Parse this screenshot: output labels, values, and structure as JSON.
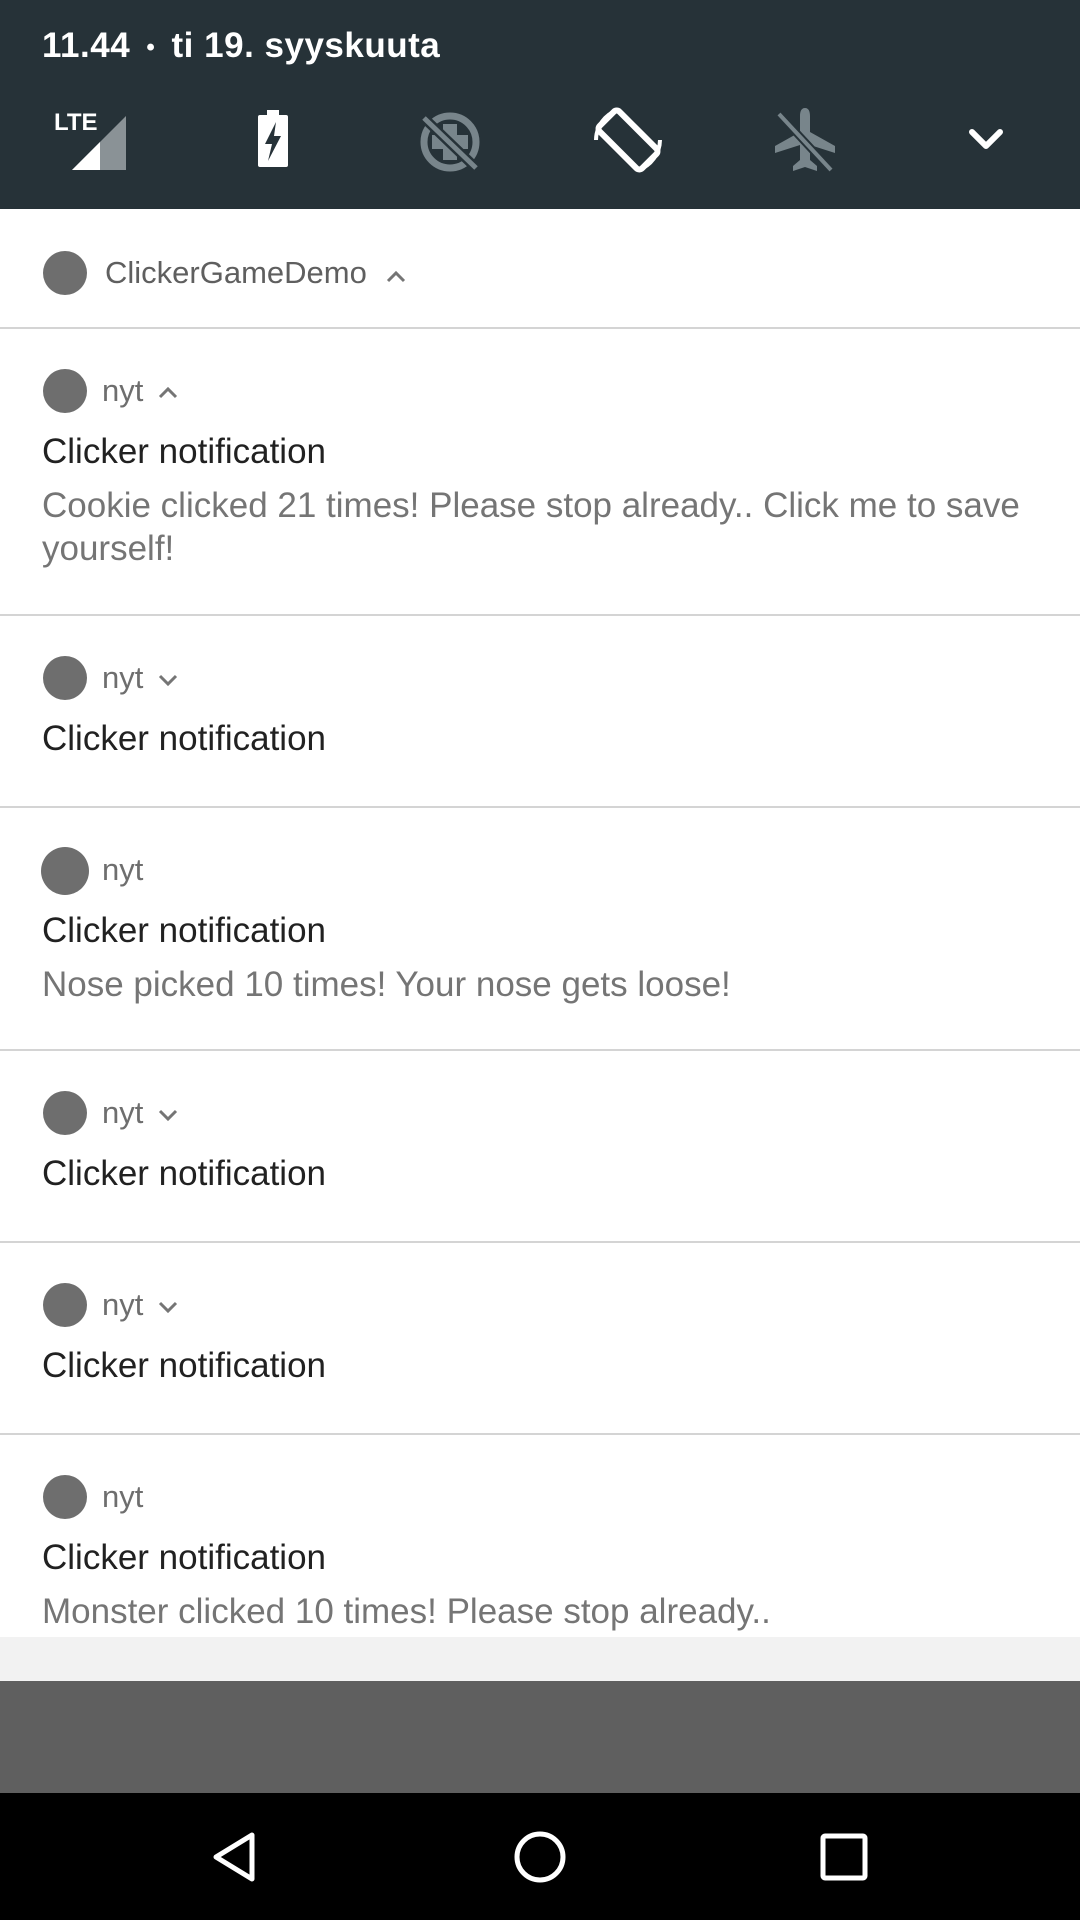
{
  "status": {
    "time": "11.44",
    "separator": "•",
    "date": "ti 19. syyskuuta"
  },
  "quick_settings": {
    "icons": [
      "lte-signal-icon",
      "battery-charging-icon",
      "data-saver-icon",
      "auto-rotate-icon",
      "airplane-mode-icon",
      "expand-chevron-icon"
    ],
    "network_label": "LTE"
  },
  "group": {
    "app_name": "ClickerGameDemo"
  },
  "notifications": [
    {
      "time": "nyt",
      "title": "Clicker notification",
      "text": "Cookie clicked 21 times! Please stop already.. Click me to save yourself!",
      "expanded": true
    },
    {
      "time": "nyt",
      "title": "Clicker notification",
      "text": "",
      "expanded": false
    },
    {
      "time": "nyt",
      "title": "Clicker notification",
      "text": "Nose picked 10 times! Your nose gets loose!",
      "expanded": null
    },
    {
      "time": "nyt",
      "title": "Clicker notification",
      "text": "",
      "expanded": false
    },
    {
      "time": "nyt",
      "title": "Clicker notification",
      "text": "",
      "expanded": false
    },
    {
      "time": "nyt",
      "title": "Clicker notification",
      "text": "Monster clicked 10 times! Please stop already..",
      "expanded": null
    }
  ],
  "navigation": {
    "icons": [
      "back-icon",
      "home-icon",
      "recents-icon"
    ]
  },
  "colors": {
    "header_bg": "#263238",
    "icon_active": "#ffffff",
    "icon_inactive": "#78858b",
    "scrim": "#5f5f5f"
  }
}
